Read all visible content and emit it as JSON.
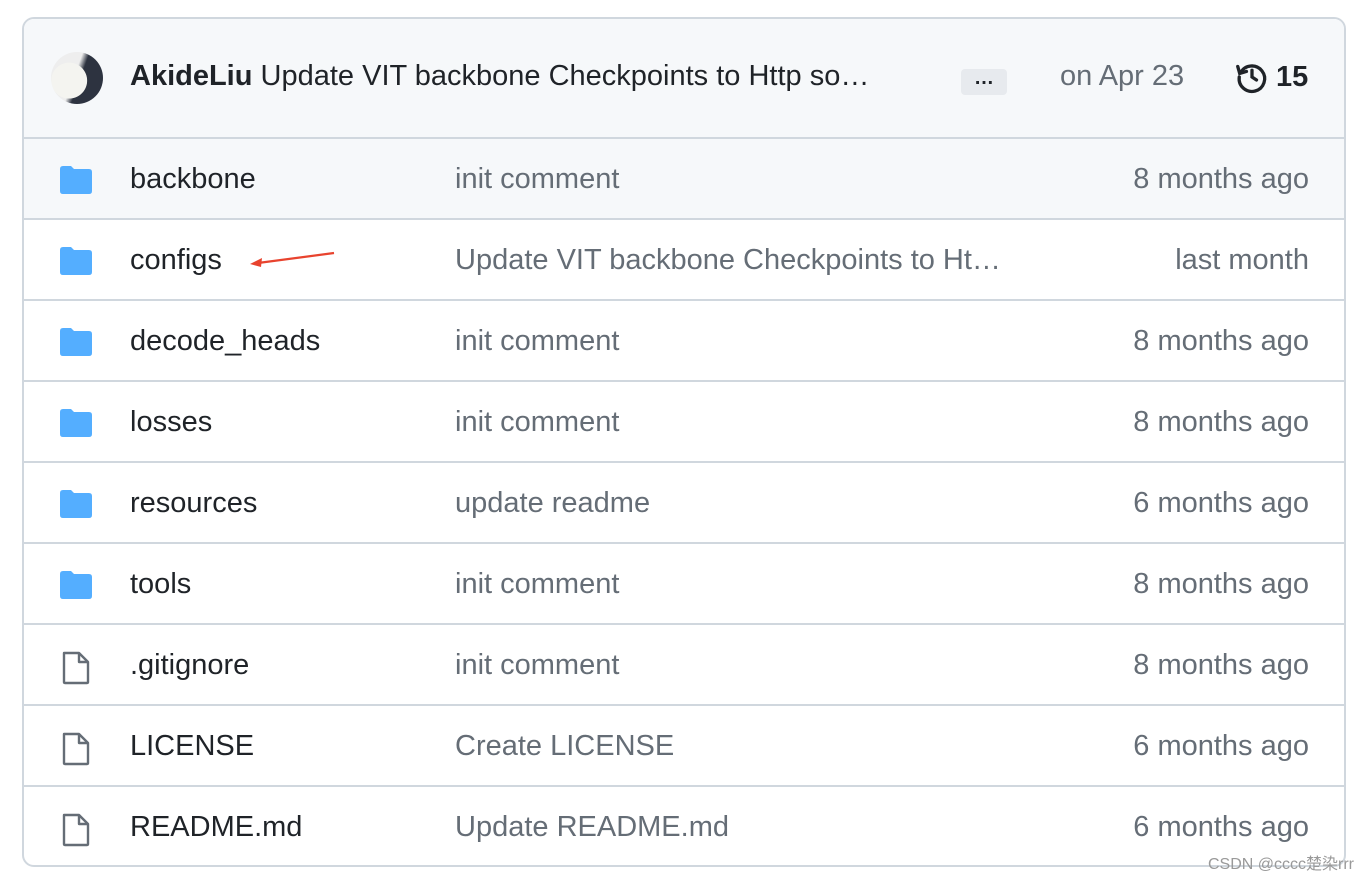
{
  "commit": {
    "author": "AkideLiu",
    "message": "Update VIT backbone Checkpoints to Http so…",
    "ellipsis": "…",
    "date": "on Apr 23",
    "history_count": "15"
  },
  "files": [
    {
      "type": "folder",
      "name": "backbone",
      "message": "init comment",
      "age": "8 months ago"
    },
    {
      "type": "folder",
      "name": "configs",
      "message": "Update VIT backbone Checkpoints to Ht…",
      "age": "last month"
    },
    {
      "type": "folder",
      "name": "decode_heads",
      "message": "init comment",
      "age": "8 months ago"
    },
    {
      "type": "folder",
      "name": "losses",
      "message": "init comment",
      "age": "8 months ago"
    },
    {
      "type": "folder",
      "name": "resources",
      "message": "update readme",
      "age": "6 months ago"
    },
    {
      "type": "folder",
      "name": "tools",
      "message": "init comment",
      "age": "8 months ago"
    },
    {
      "type": "file",
      "name": ".gitignore",
      "message": "init comment",
      "age": "8 months ago"
    },
    {
      "type": "file",
      "name": "LICENSE",
      "message": "Create LICENSE",
      "age": "6 months ago"
    },
    {
      "type": "file",
      "name": "README.md",
      "message": "Update README.md",
      "age": "6 months ago"
    }
  ],
  "colors": {
    "folder": "#54aeff",
    "annotation_arrow": "#e8432e"
  },
  "watermark": "CSDN @cccc楚染rrr"
}
